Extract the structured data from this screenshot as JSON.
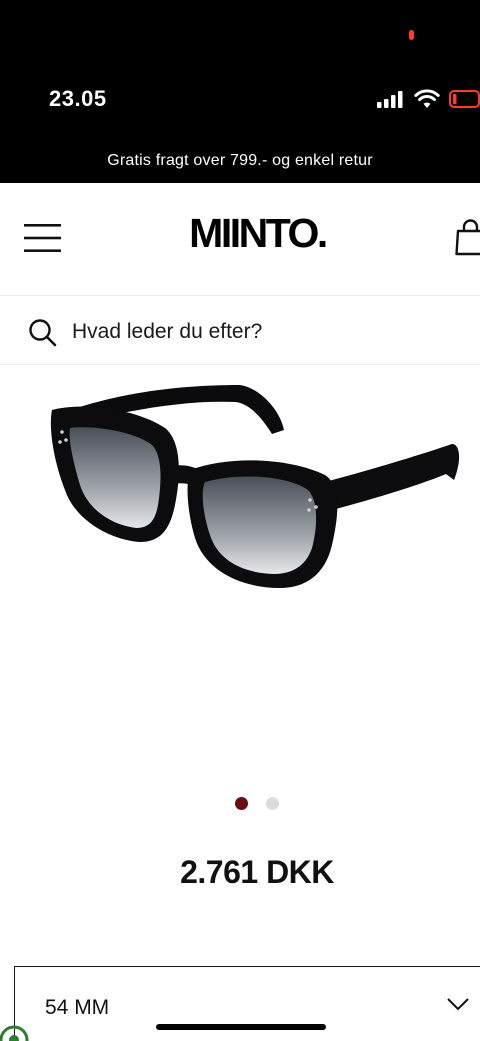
{
  "status_bar": {
    "time": "23.05"
  },
  "promo_banner": {
    "text": "Gratis fragt over 799.- og enkel retur"
  },
  "header": {
    "logo": "MIINTO."
  },
  "search": {
    "placeholder": "Hvad leder du efter?"
  },
  "product": {
    "image_alt": "sunglasses-image",
    "carousel": {
      "count": 2,
      "active": 1
    },
    "price": "2.761 DKK",
    "size": "54 MM"
  },
  "colors": {
    "active_dot": "#6a0c13",
    "inactive_dot": "#dcdcdc",
    "battery_low": "#ff3b30"
  }
}
